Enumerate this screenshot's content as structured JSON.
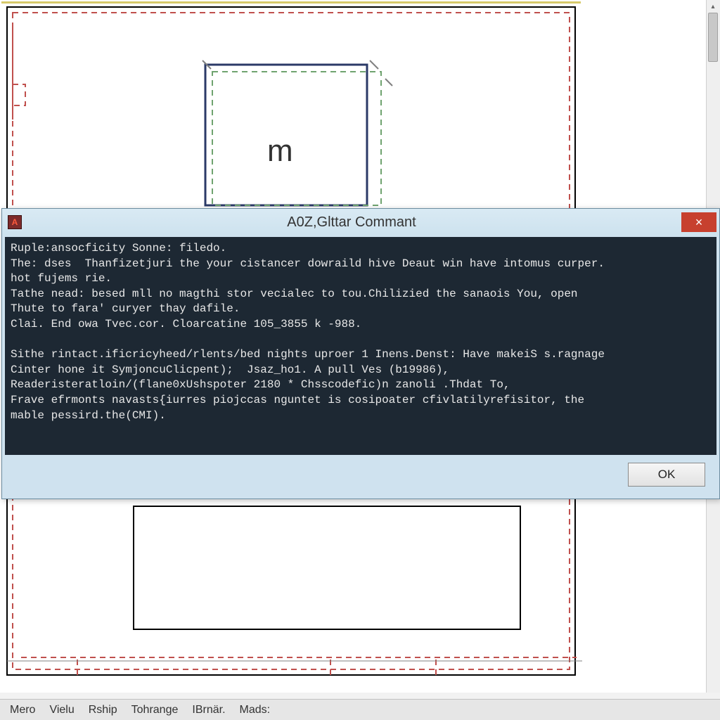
{
  "canvas": {
    "m_label": "m"
  },
  "dialog": {
    "title": "A0Z,Glttar Commant",
    "close_label": "×",
    "body": "Ruple:ansocficity Sonne: filedo.\nThe: dses  Thanfizetjuri the your cistancer dowraild hive Deaut win have intomus curper.\nhot fujems rie.\nTathe nead: besed mll no magthi stor vecialec to tou.Chilizied the sanaois You, open\nThute to fara' curyer thay dafile.\nClai. End owa Tvec.cor. Cloarcatine 105_3855 k -988.\n\nSithe rintact.ificricyheed/rlents/bed nights uproer 1 Inens.Denst: Have makeiS s.ragnage\nCinter hone it SymjoncuClicpent);  Jsaz_ho1. A pull Ves (b19986),\nReaderisteratloin/(flane0xUshspoter 2180 * Chsscodefic)n zanoli .Thdat To,\nFrave efrmonts navasts{iurres piojccas nguntet is cosipoater cfivlatilyrefisitor, the\nmable pessird.the(CMI).",
    "ok_label": "OK"
  },
  "menu": {
    "items": [
      "Mero",
      "Vielu",
      "Rship",
      "Tohrange",
      "IBrnär.",
      "Mads:"
    ]
  }
}
